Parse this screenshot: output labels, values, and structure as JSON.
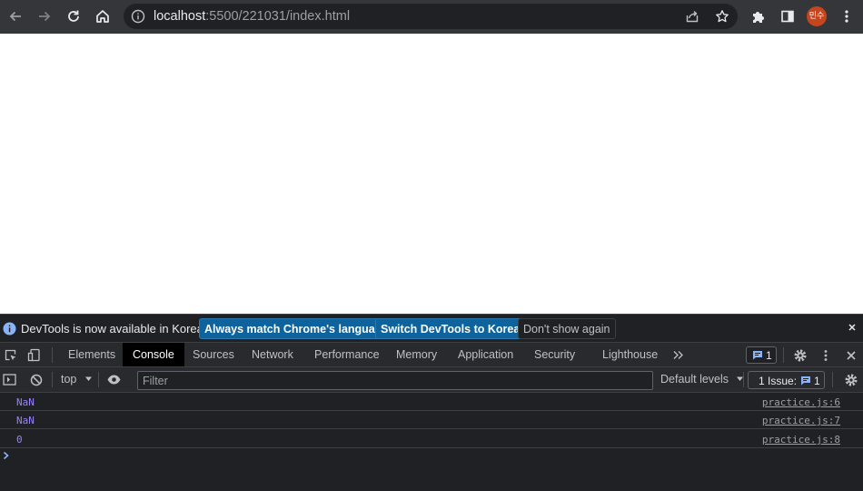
{
  "browser": {
    "url_host": "localhost",
    "url_path": ":5500/221031/index.html",
    "profile_initials": "민수",
    "colors": {
      "toolbar": "#35363a",
      "omnibox": "#202124",
      "avatar": "#c5451f"
    }
  },
  "devtools": {
    "infobar": {
      "message": "DevTools is now available in Korean!",
      "btn_match_language": "Always match Chrome's language",
      "btn_switch": "Switch DevTools to Korean",
      "btn_dont_show": "Don't show again"
    },
    "tabs": [
      "Elements",
      "Console",
      "Sources",
      "Network",
      "Performance",
      "Memory",
      "Application",
      "Security",
      "Lighthouse"
    ],
    "active_tab": "Console",
    "messages_badge_count": "1",
    "console_toolbar": {
      "context": "top",
      "filter_placeholder": "Filter",
      "levels_label": "Default levels",
      "issues_label": "1 Issue:",
      "issues_count": "1"
    },
    "console_messages": [
      {
        "value": "NaN",
        "source": "practice.js:6"
      },
      {
        "value": "NaN",
        "source": "practice.js:7"
      },
      {
        "value": "0",
        "source": "practice.js:8"
      }
    ],
    "colors": {
      "accent": "#8ab4f8",
      "primary_button": "#0e639c",
      "log_value": "#9980ff"
    }
  }
}
